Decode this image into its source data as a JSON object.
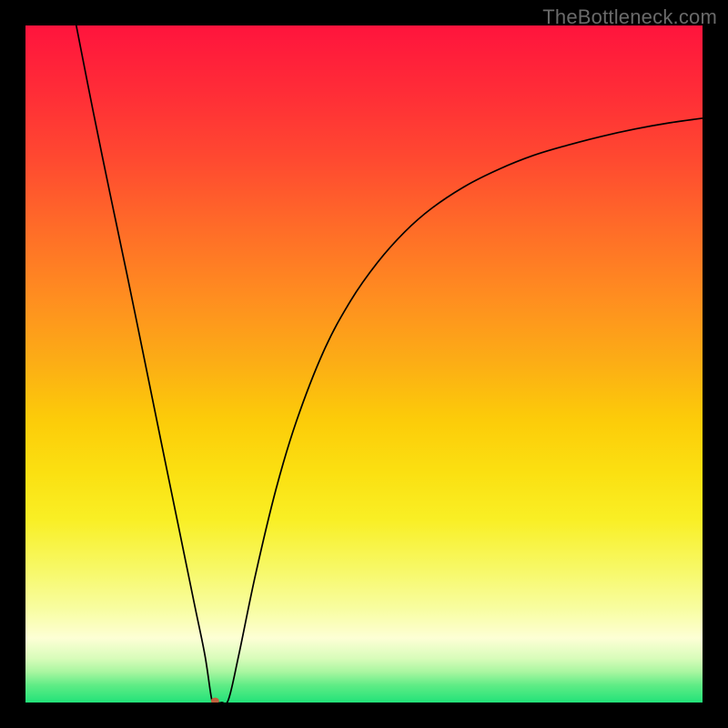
{
  "watermark": "TheBottleneck.com",
  "chart_data": {
    "type": "line",
    "title": "",
    "xlabel": "",
    "ylabel": "",
    "xlim": [
      0,
      100
    ],
    "ylim": [
      0,
      100
    ],
    "grid": false,
    "marker": {
      "x": 28,
      "y": 0,
      "color": "#c15f3c",
      "radius": 1.1
    },
    "series": [
      {
        "name": "curve",
        "color": "#000000",
        "points": [
          {
            "x": 7.5,
            "y": 100
          },
          {
            "x": 10,
            "y": 87.3
          },
          {
            "x": 12.5,
            "y": 75.1
          },
          {
            "x": 15,
            "y": 63.2
          },
          {
            "x": 17.5,
            "y": 51.0
          },
          {
            "x": 20,
            "y": 38.7
          },
          {
            "x": 22.5,
            "y": 26.5
          },
          {
            "x": 25,
            "y": 14.3
          },
          {
            "x": 26.5,
            "y": 7.0
          },
          {
            "x": 27.5,
            "y": 0.5
          },
          {
            "x": 28.0,
            "y": 0.0
          },
          {
            "x": 29.0,
            "y": 0.0
          },
          {
            "x": 30.0,
            "y": 0.5
          },
          {
            "x": 31.5,
            "y": 7.0
          },
          {
            "x": 34,
            "y": 19.0
          },
          {
            "x": 37,
            "y": 31.5
          },
          {
            "x": 40,
            "y": 41.5
          },
          {
            "x": 44,
            "y": 51.8
          },
          {
            "x": 48,
            "y": 59.3
          },
          {
            "x": 52,
            "y": 65.0
          },
          {
            "x": 56,
            "y": 69.5
          },
          {
            "x": 60,
            "y": 73.0
          },
          {
            "x": 65,
            "y": 76.3
          },
          {
            "x": 70,
            "y": 78.8
          },
          {
            "x": 75,
            "y": 80.8
          },
          {
            "x": 80,
            "y": 82.3
          },
          {
            "x": 85,
            "y": 83.6
          },
          {
            "x": 90,
            "y": 84.7
          },
          {
            "x": 95,
            "y": 85.6
          },
          {
            "x": 100,
            "y": 86.3
          }
        ]
      }
    ],
    "gradient_bands": [
      {
        "offset": 0.0,
        "color": "#ff143d"
      },
      {
        "offset": 0.1,
        "color": "#ff2d37"
      },
      {
        "offset": 0.2,
        "color": "#ff4a30"
      },
      {
        "offset": 0.3,
        "color": "#ff6c28"
      },
      {
        "offset": 0.4,
        "color": "#ff8d20"
      },
      {
        "offset": 0.5,
        "color": "#fcae15"
      },
      {
        "offset": 0.58,
        "color": "#fccb09"
      },
      {
        "offset": 0.66,
        "color": "#fbe011"
      },
      {
        "offset": 0.73,
        "color": "#f9ef25"
      },
      {
        "offset": 0.8,
        "color": "#f7f864"
      },
      {
        "offset": 0.86,
        "color": "#f8fd9f"
      },
      {
        "offset": 0.905,
        "color": "#fdffd5"
      },
      {
        "offset": 0.935,
        "color": "#d8fcba"
      },
      {
        "offset": 0.955,
        "color": "#a8f6a0"
      },
      {
        "offset": 0.975,
        "color": "#5eec85"
      },
      {
        "offset": 1.0,
        "color": "#22e279"
      }
    ]
  }
}
